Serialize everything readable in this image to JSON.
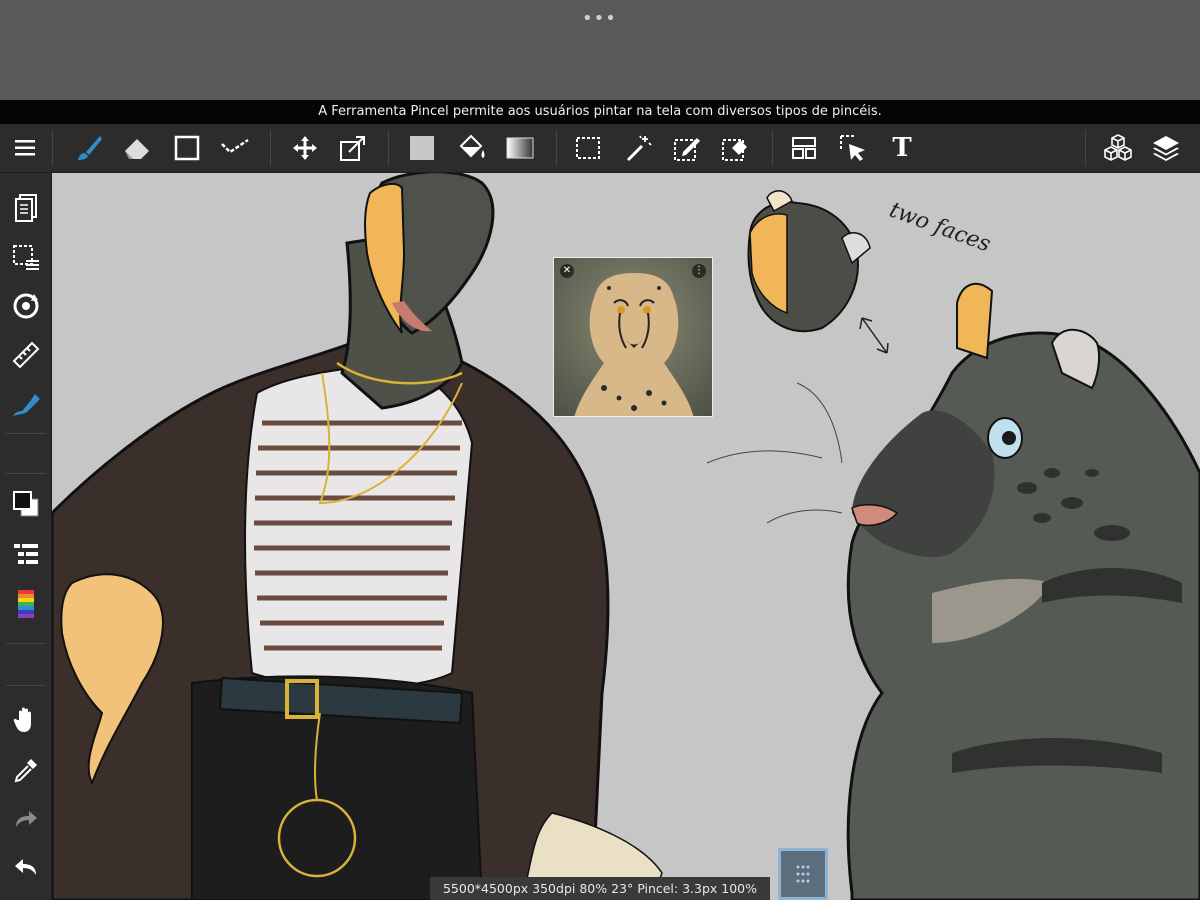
{
  "system": {
    "multitask_indicator": "•••"
  },
  "tooltip": {
    "text": "A Ferramenta Pincel permite aos usuários pintar na tela com diversos tipos de pincéis."
  },
  "toolbar": {
    "items": [
      {
        "name": "menu",
        "icon": "hamburger-icon"
      },
      {
        "name": "brush",
        "icon": "brush-icon",
        "active": true
      },
      {
        "name": "eraser",
        "icon": "eraser-icon"
      },
      {
        "name": "shape",
        "icon": "rectangle-icon"
      },
      {
        "name": "correction",
        "icon": "checkmark-stroke-icon"
      },
      {
        "name": "move",
        "icon": "move-arrows-icon"
      },
      {
        "name": "transform",
        "icon": "transform-icon"
      },
      {
        "name": "fill",
        "icon": "fill-square-icon"
      },
      {
        "name": "bucket",
        "icon": "paint-bucket-icon"
      },
      {
        "name": "gradient",
        "icon": "gradient-icon"
      },
      {
        "name": "selection",
        "icon": "marquee-select-icon"
      },
      {
        "name": "magic-wand",
        "icon": "magic-wand-icon"
      },
      {
        "name": "selection-pen",
        "icon": "select-pen-icon"
      },
      {
        "name": "selection-eraser",
        "icon": "select-eraser-icon"
      },
      {
        "name": "frame-divider",
        "icon": "panel-layout-icon"
      },
      {
        "name": "select-layer",
        "icon": "pointer-select-icon"
      },
      {
        "name": "text",
        "icon": "text-icon",
        "label": "T"
      },
      {
        "name": "3d-material",
        "icon": "cubes-icon"
      },
      {
        "name": "layers",
        "icon": "layers-icon"
      }
    ]
  },
  "sidebar": {
    "items": [
      {
        "name": "pages",
        "icon": "pages-icon"
      },
      {
        "name": "selection-menu",
        "icon": "selection-menu-icon"
      },
      {
        "name": "rotate",
        "icon": "rotate-icon"
      },
      {
        "name": "ruler",
        "icon": "ruler-icon"
      },
      {
        "name": "snap-pen",
        "icon": "snap-pen-icon"
      },
      {
        "name": "color-fill-stroke",
        "icon": "color-swatch-icon"
      },
      {
        "name": "layer-properties",
        "icon": "layer-list-icon"
      },
      {
        "name": "color-palette",
        "icon": "rainbow-icon"
      },
      {
        "name": "hand",
        "icon": "hand-icon"
      },
      {
        "name": "eyedropper",
        "icon": "eyedropper-icon"
      },
      {
        "name": "redo",
        "icon": "redo-icon"
      },
      {
        "name": "undo",
        "icon": "undo-icon"
      }
    ]
  },
  "canvas": {
    "background_color": "#c6c6c6",
    "annotation_text": "two faces"
  },
  "status": {
    "text": "5500*4500px 350dpi 80% 23° Pincel: 3.3px 100%"
  },
  "colors": {
    "accent": "#2f8fce",
    "ui_bg": "#2c2c2c",
    "tooltip_bg": "#050505"
  }
}
